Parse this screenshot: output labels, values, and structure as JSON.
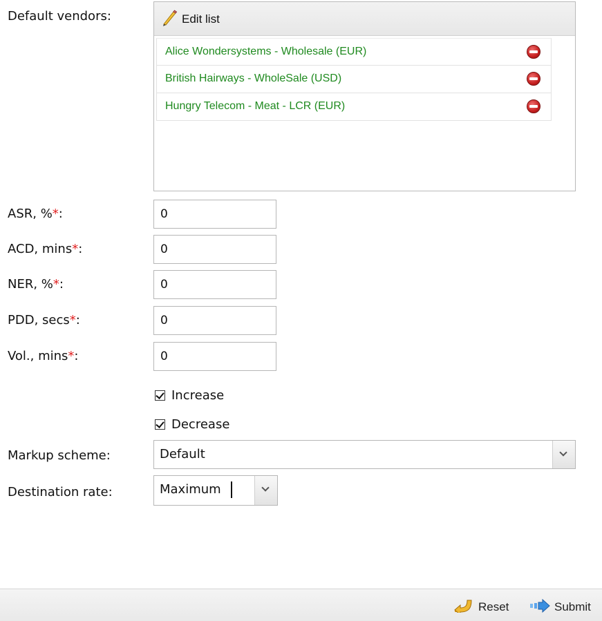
{
  "vendors": {
    "label": "Default vendors:",
    "edit_label": "Edit list",
    "items": [
      {
        "name": "Alice Wondersystems - Wholesale (EUR)"
      },
      {
        "name": "British Hairways - WholeSale (USD)"
      },
      {
        "name": "Hungry Telecom - Meat - LCR (EUR)"
      }
    ]
  },
  "fields": {
    "asr": {
      "label": "ASR, %",
      "value": "0"
    },
    "acd": {
      "label": "ACD, mins",
      "value": "0"
    },
    "ner": {
      "label": "NER, %",
      "value": "0"
    },
    "pdd": {
      "label": "PDD, secs",
      "value": "0"
    },
    "vol": {
      "label": "Vol., mins",
      "value": "0"
    },
    "required_mark": "*",
    "colon": ":"
  },
  "checkboxes": {
    "increase": {
      "label": "Increase",
      "checked": true
    },
    "decrease": {
      "label": "Decrease",
      "checked": true
    }
  },
  "markup": {
    "label": "Markup scheme:",
    "selected": "Default"
  },
  "destination": {
    "label": "Destination rate:",
    "selected": "Maximum"
  },
  "footer": {
    "reset_label": "Reset",
    "submit_label": "Submit"
  },
  "colors": {
    "vendor_text": "#1f8a1f",
    "required": "#e02020"
  }
}
